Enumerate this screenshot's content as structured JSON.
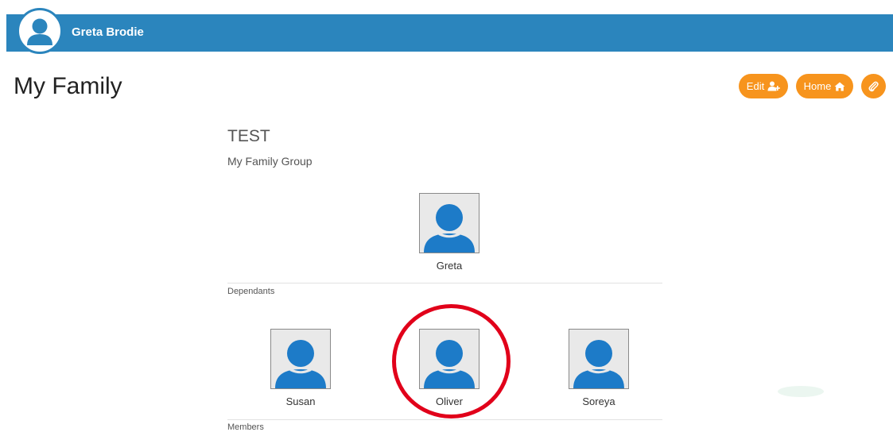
{
  "header": {
    "user_name": "Greta Brodie",
    "avatar_icon": "user-avatar-icon"
  },
  "page": {
    "title": "My Family"
  },
  "actions": {
    "edit_label": "Edit",
    "edit_icon": "add-user-icon",
    "home_label": "Home",
    "home_icon": "home-icon",
    "clip_icon": "paperclip-icon"
  },
  "group": {
    "name": "TEST",
    "subtitle": "My Family Group",
    "head": {
      "name": "Greta",
      "icon": "person-silhouette-icon"
    },
    "dependants_label": "Dependants",
    "dependants": [
      {
        "name": "Susan",
        "icon": "person-silhouette-icon"
      },
      {
        "name": "Oliver",
        "icon": "person-silhouette-icon",
        "highlighted": true
      },
      {
        "name": "Soreya",
        "icon": "person-silhouette-icon"
      }
    ],
    "members_label": "Members"
  },
  "colors": {
    "header_bar": "#2b85bd",
    "button": "#f7941d",
    "avatar_figure": "#1d7bc8",
    "highlight": "#e1001a"
  }
}
